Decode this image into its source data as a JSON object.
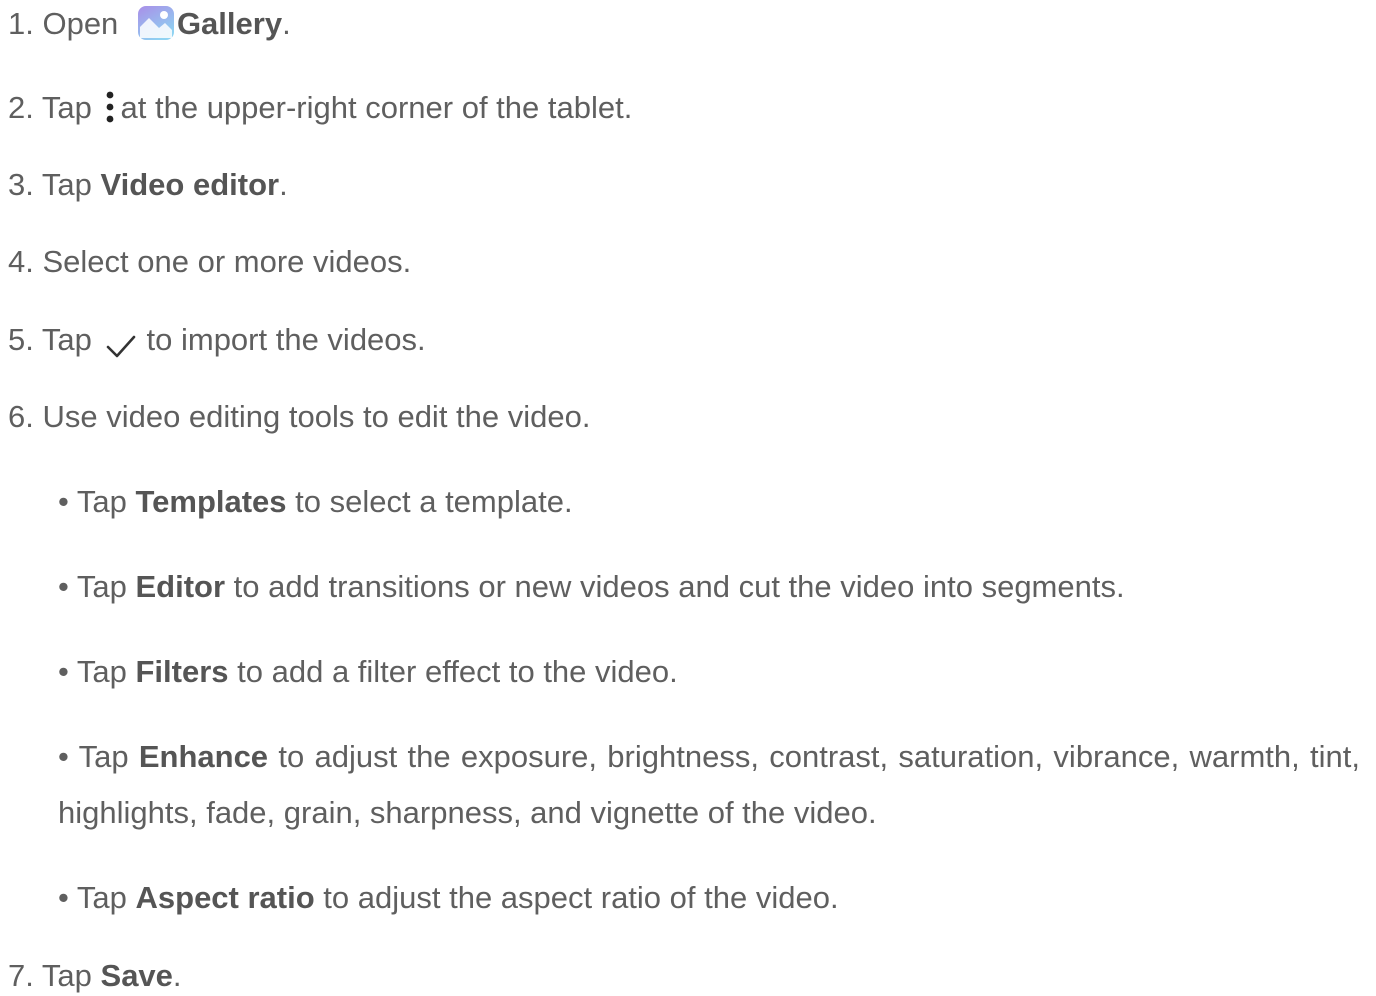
{
  "steps": {
    "s1": {
      "prefix": "1. Open",
      "bold": "Gallery",
      "suffix": "."
    },
    "s2": {
      "prefix": "2. Tap",
      "suffix": "at the upper-right corner of the tablet."
    },
    "s3": {
      "prefix": "3. Tap ",
      "bold": "Video editor",
      "suffix": "."
    },
    "s4": {
      "text": "4. Select one or more videos."
    },
    "s5": {
      "prefix": "5. Tap",
      "suffix": "to import the videos."
    },
    "s6": {
      "text": "6. Use video editing tools to edit the video."
    },
    "s7": {
      "prefix": "7. Tap ",
      "bold": "Save",
      "suffix": "."
    }
  },
  "bullets": {
    "b1": {
      "prefix": "• Tap ",
      "bold": "Templates",
      "suffix": " to select a template."
    },
    "b2": {
      "prefix": "• Tap ",
      "bold": "Editor",
      "suffix": " to add transitions or new videos and cut the video into segments."
    },
    "b3": {
      "prefix": "• Tap ",
      "bold": "Filters",
      "suffix": " to add a filter effect to the video."
    },
    "b4": {
      "prefix": "• Tap ",
      "bold": "Enhance",
      "suffix": " to adjust the exposure, brightness, contrast, saturation, vibrance, warmth, tint, highlights, fade, grain, sharpness, and vignette of the video."
    },
    "b5": {
      "prefix": "• Tap ",
      "bold": "Aspect ratio",
      "suffix": " to adjust the aspect ratio of the video."
    }
  },
  "icons": {
    "gallery": "gallery-app-icon",
    "more": "more-vertical-icon",
    "check": "checkmark-icon"
  },
  "colors": {
    "text": "#5f5f5f",
    "bold_text": "#555555",
    "gallery_icon_top": "#a98ee8",
    "gallery_icon_bottom": "#8fd3f2"
  }
}
